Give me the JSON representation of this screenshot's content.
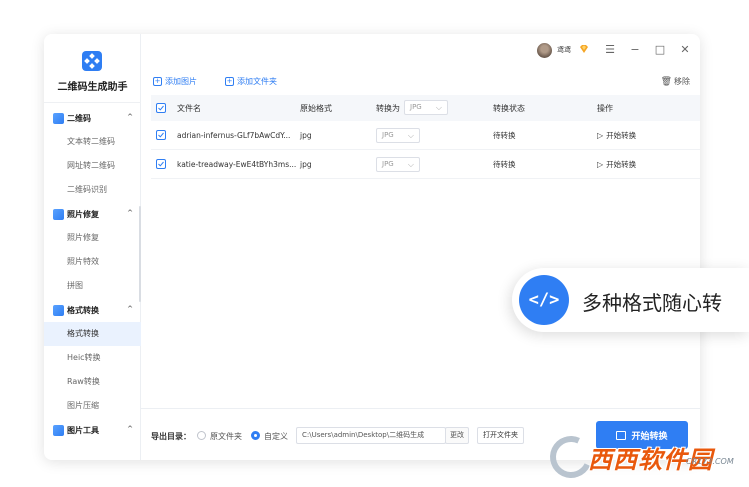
{
  "app": {
    "title": "二维码生成助手"
  },
  "sidebar": {
    "groups": [
      {
        "label": "二维码",
        "items": [
          "文本转二维码",
          "网址转二维码",
          "二维码识别"
        ]
      },
      {
        "label": "照片修复",
        "items": [
          "照片修复",
          "照片特效",
          "拼图"
        ]
      },
      {
        "label": "格式转换",
        "items": [
          "格式转换",
          "Heic转换",
          "Raw转换",
          "图片压缩"
        ]
      },
      {
        "label": "图片工具",
        "items": []
      }
    ],
    "active_item": "格式转换"
  },
  "titlebar": {
    "username": "鸢鸢",
    "menu_icon": "hamburger-icon",
    "minimize_icon": "minimize-icon",
    "maximize_icon": "maximize-icon",
    "close_icon": "close-icon"
  },
  "toolbar": {
    "add_image": "添加图片",
    "add_folder": "添加文件夹",
    "remove": "移除"
  },
  "table": {
    "headers": {
      "name": "文件名",
      "orig_format": "原始格式",
      "convert_to": "转换为",
      "convert_to_value": "JPG",
      "status": "转换状态",
      "action": "操作"
    },
    "rows": [
      {
        "name": "adrian-infernus-GLf7bAwCdY...",
        "format": "jpg",
        "target": "JPG",
        "status": "待转换",
        "action": "开始转换"
      },
      {
        "name": "katie-treadway-EwE4tBYh3ms...",
        "format": "jpg",
        "target": "JPG",
        "status": "待转换",
        "action": "开始转换"
      }
    ]
  },
  "bottom": {
    "output_label": "导出目录：",
    "opt_original": "原文件夹",
    "opt_custom": "自定义",
    "path": "C:\\Users\\admin\\Desktop\\二维码生成",
    "change": "更改",
    "open_folder": "打开文件夹",
    "start_all": "开始转换"
  },
  "promo": {
    "icon_text": "</>",
    "text": "多种格式随心转"
  },
  "watermark": {
    "text": "西西软件园",
    "sub": "CR173.COM"
  },
  "colors": {
    "accent": "#2f7ef3",
    "watermark": "#e9580c"
  }
}
